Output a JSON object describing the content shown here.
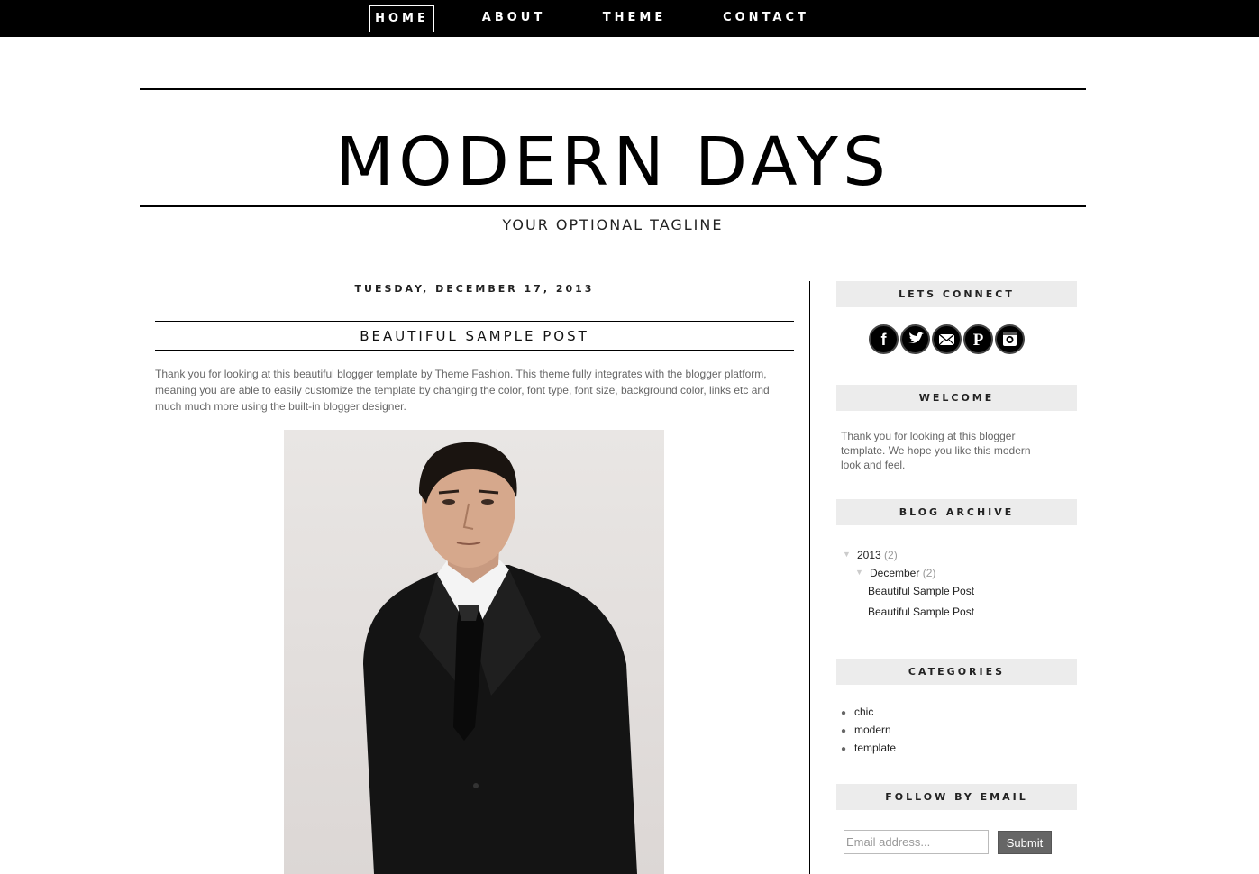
{
  "nav": {
    "items": [
      {
        "label": "HOME",
        "active": true
      },
      {
        "label": "ABOUT",
        "active": false
      },
      {
        "label": "THEME",
        "active": false
      },
      {
        "label": "CONTACT",
        "active": false
      }
    ]
  },
  "header": {
    "title": "MODERN DAYS",
    "tagline": "YOUR OPTIONAL TAGLINE"
  },
  "post": {
    "date": "TUESDAY, DECEMBER 17, 2013",
    "title": "BEAUTIFUL SAMPLE POST",
    "body": "Thank you for looking at this beautiful blogger template by Theme Fashion. This theme fully integrates with the blogger platform, meaning you are able to easily customize the template by changing the color, font type, font size, background color, links etc and much much more using the built-in blogger designer."
  },
  "sidebar": {
    "connect": {
      "title": "LETS CONNECT",
      "icons": [
        "facebook-icon",
        "twitter-icon",
        "email-icon",
        "pinterest-icon",
        "instagram-icon"
      ]
    },
    "welcome": {
      "title": "WELCOME",
      "text": "Thank you for looking at this blogger template. We hope you like this modern look and feel."
    },
    "archive": {
      "title": "BLOG ARCHIVE",
      "year": "2013",
      "year_count": "(2)",
      "month": "December",
      "month_count": "(2)",
      "posts": [
        "Beautiful Sample Post",
        "Beautiful Sample Post"
      ],
      "toggle": "▼"
    },
    "categories": {
      "title": "CATEGORIES",
      "items": [
        "chic",
        "modern",
        "template"
      ]
    },
    "follow": {
      "title": "FOLLOW BY EMAIL",
      "placeholder": "Email address...",
      "submit": "Submit"
    }
  },
  "colors": {
    "nav_bg": "#000000",
    "widget_bg": "#ececec",
    "body_text": "#666666",
    "submit_bg": "#666666"
  }
}
